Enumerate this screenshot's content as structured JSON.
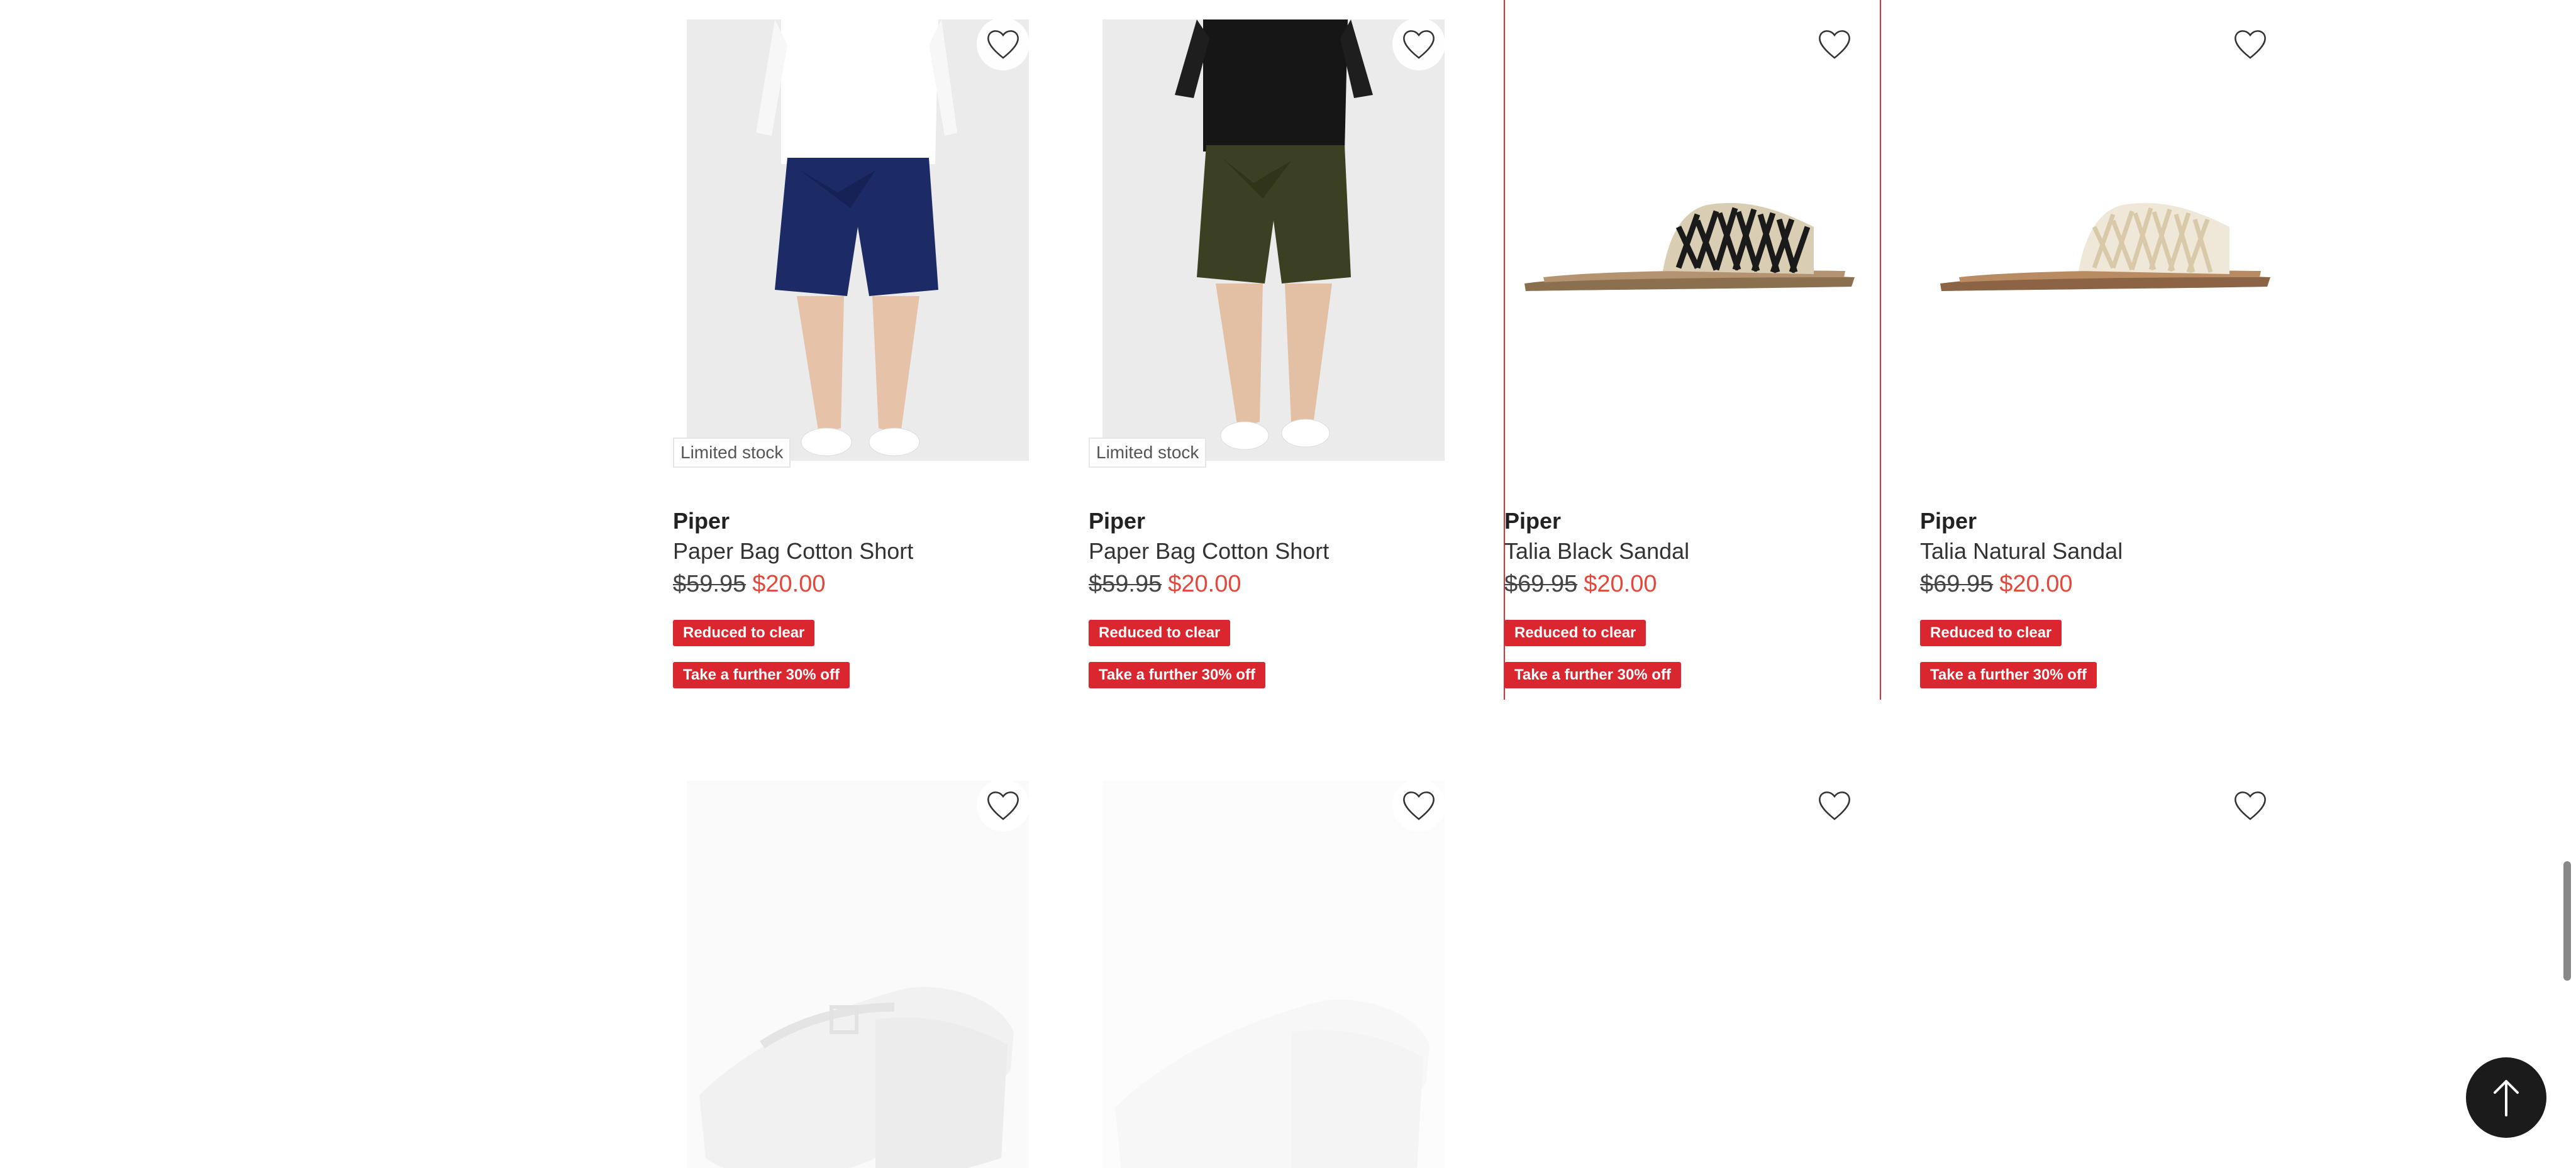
{
  "colors": {
    "sale_red": "#e2483b",
    "badge_red": "#d9262f",
    "highlight_border": "#e22b35",
    "back_to_top_bg": "#1b1b1b"
  },
  "products_row1": [
    {
      "badge": "Limited stock",
      "brand": "Piper",
      "name": "Paper Bag Cotton Short",
      "original_price": "$59.95",
      "sale_price": "$20.00",
      "promo_1": "Reduced to clear",
      "promo_2": "Take a further 30% off",
      "image": "navy-shorts-model",
      "wishlist_icon": "heart-icon"
    },
    {
      "badge": "Limited stock",
      "brand": "Piper",
      "name": "Paper Bag Cotton Short",
      "original_price": "$59.95",
      "sale_price": "$20.00",
      "promo_1": "Reduced to clear",
      "promo_2": "Take a further 30% off",
      "image": "olive-shorts-model",
      "wishlist_icon": "heart-icon"
    },
    {
      "brand": "Piper",
      "name": "Talia Black Sandal",
      "original_price": "$69.95",
      "sale_price": "$20.00",
      "promo_1": "Reduced to clear",
      "promo_2": "Take a further 30% off",
      "image": "black-woven-slide-sandal",
      "wishlist_icon": "heart-icon"
    },
    {
      "brand": "Piper",
      "name": "Talia Natural Sandal",
      "original_price": "$69.95",
      "sale_price": "$20.00",
      "promo_1": "Reduced to clear",
      "promo_2": "Take a further 30% off",
      "image": "natural-woven-slide-sandal",
      "wishlist_icon": "heart-icon"
    }
  ],
  "products_row2": [
    {
      "image": "white-wedge-sandal",
      "wishlist_icon": "heart-icon"
    },
    {
      "image": "white-wedge-sandal-loading",
      "wishlist_icon": "heart-icon"
    },
    {
      "image": "loading-placeholder",
      "wishlist_icon": "heart-icon"
    },
    {
      "image": "loading-placeholder",
      "wishlist_icon": "heart-icon"
    }
  ],
  "back_to_top_icon": "arrow-up-icon"
}
